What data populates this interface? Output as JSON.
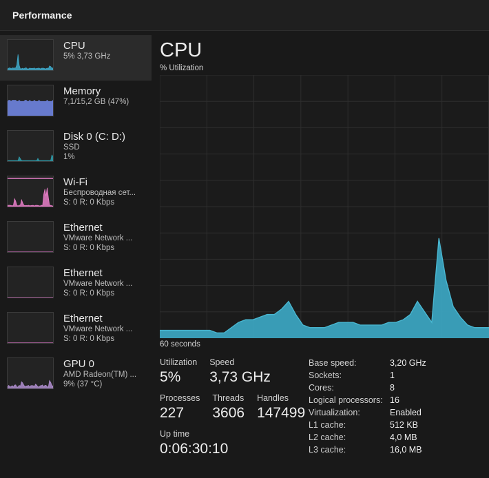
{
  "window": {
    "title": "Performance"
  },
  "sidebar": {
    "items": [
      {
        "name": "CPU",
        "sub1": "5%  3,73 GHz",
        "sub2": "",
        "selected": true,
        "icon": "cpu-sparkline",
        "color": "#3fa9c9",
        "style": "spiky"
      },
      {
        "name": "Memory",
        "sub1": "7,1/15,2 GB (47%)",
        "sub2": "",
        "selected": false,
        "icon": "memory-sparkline",
        "color": "#6b7fd7",
        "style": "filled47"
      },
      {
        "name": "Disk 0 (C: D:)",
        "sub1": "SSD",
        "sub2": "1%",
        "selected": false,
        "icon": "disk-sparkline",
        "color": "#2f9aa8",
        "style": "flat"
      },
      {
        "name": "Wi-Fi",
        "sub1": "Беспроводная сет...",
        "sub2": "S: 0 R: 0 Kbps",
        "selected": false,
        "icon": "wifi-sparkline",
        "color": "#e87ec8",
        "style": "wifi"
      },
      {
        "name": "Ethernet",
        "sub1": "VMware Network ...",
        "sub2": "S: 0 R: 0 Kbps",
        "selected": false,
        "icon": "ethernet-sparkline",
        "color": "#c06ab0",
        "style": "baseline"
      },
      {
        "name": "Ethernet",
        "sub1": "VMware Network ...",
        "sub2": "S: 0 R: 0 Kbps",
        "selected": false,
        "icon": "ethernet-sparkline",
        "color": "#c06ab0",
        "style": "baseline"
      },
      {
        "name": "Ethernet",
        "sub1": "VMware Network ...",
        "sub2": "S: 0 R: 0 Kbps",
        "selected": false,
        "icon": "ethernet-sparkline",
        "color": "#c06ab0",
        "style": "baseline"
      },
      {
        "name": "GPU 0",
        "sub1": "AMD Radeon(TM) ...",
        "sub2": "9%  (37 °C)",
        "selected": false,
        "icon": "gpu-sparkline",
        "color": "#b08ed0",
        "style": "gpu"
      }
    ]
  },
  "main": {
    "title": "CPU",
    "graph_label": "% Utilization",
    "axis_left": "60 seconds",
    "axis_right": "",
    "colors": {
      "fill": "#3ba3bf",
      "line": "#49b6d0",
      "grid": "#2e2e2e",
      "plot_bg": "#1b1b1b"
    }
  },
  "chart_data": {
    "type": "area",
    "title": "CPU % Utilization",
    "xlabel": "60 seconds",
    "ylabel": "% Utilization",
    "ylim": [
      0,
      100
    ],
    "xlim": [
      0,
      60
    ],
    "grid": true,
    "grid_cols": 7,
    "grid_rows": 10,
    "series": [
      {
        "name": "% Utilization",
        "values": [
          3,
          3,
          3,
          3,
          3,
          3,
          3,
          3,
          2,
          2,
          4,
          6,
          7,
          7,
          8,
          9,
          9,
          11,
          14,
          9,
          5,
          4,
          4,
          4,
          5,
          6,
          6,
          6,
          5,
          5,
          5,
          5,
          6,
          6,
          7,
          9,
          14,
          10,
          6,
          38,
          22,
          12,
          8,
          5,
          4,
          4,
          4
        ]
      }
    ]
  },
  "stats": {
    "left": [
      [
        {
          "caption": "Utilization",
          "value": "5%"
        },
        {
          "caption": "Speed",
          "value": "3,73 GHz"
        }
      ],
      [
        {
          "caption": "Processes",
          "value": "227"
        },
        {
          "caption": "Threads",
          "value": "3606"
        },
        {
          "caption": "Handles",
          "value": "147499"
        }
      ],
      [
        {
          "caption": "Up time",
          "value": "0:06:30:10"
        }
      ]
    ],
    "right": [
      {
        "key": "Base speed:",
        "value": "3,20 GHz"
      },
      {
        "key": "Sockets:",
        "value": "1"
      },
      {
        "key": "Cores:",
        "value": "8"
      },
      {
        "key": "Logical processors:",
        "value": "16"
      },
      {
        "key": "Virtualization:",
        "value": "Enabled"
      },
      {
        "key": "L1 cache:",
        "value": "512 KB"
      },
      {
        "key": "L2 cache:",
        "value": "4,0 MB"
      },
      {
        "key": "L3 cache:",
        "value": "16,0 MB"
      }
    ]
  }
}
